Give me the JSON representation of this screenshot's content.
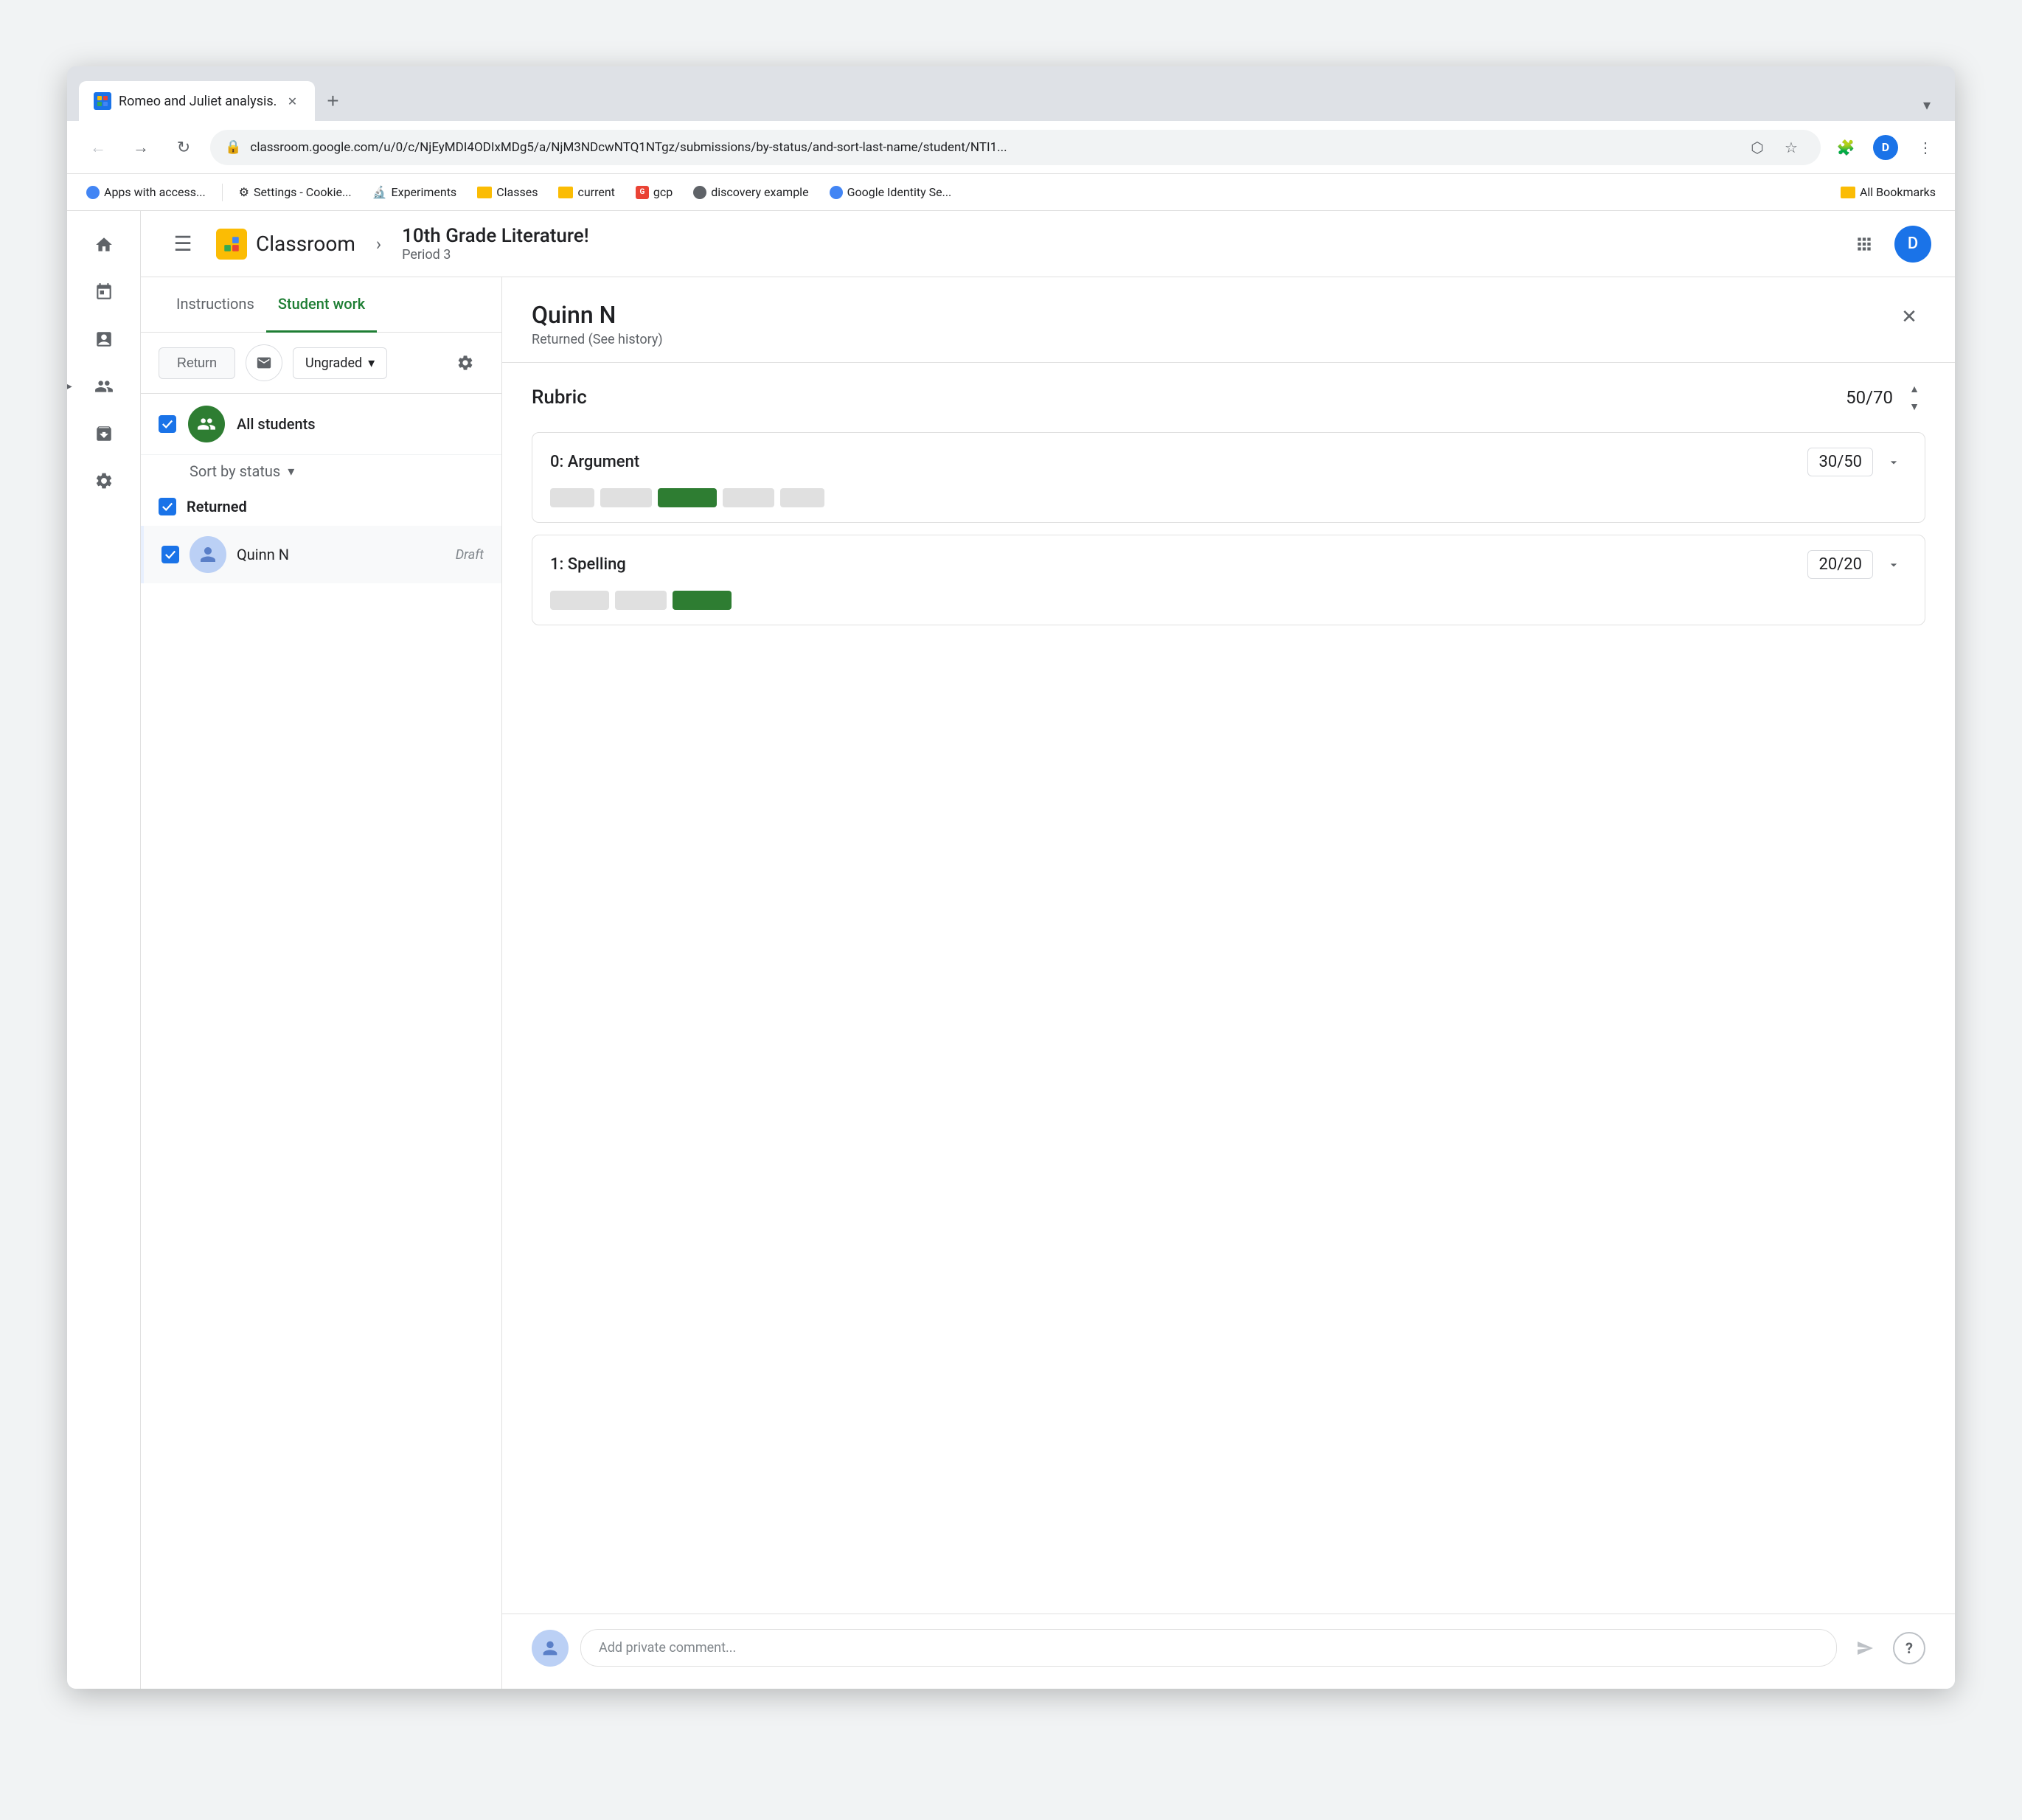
{
  "browser": {
    "tab_title": "Romeo and Juliet analysis.",
    "url": "classroom.google.com/u/0/c/NjEyMDI4ODIxMDg5/a/NjM3NDcwNTQ1NTgz/submissions/by-status/and-sort-last-name/student/NTI1...",
    "new_tab_label": "+",
    "chevron_label": "▾",
    "bookmarks": [
      {
        "label": "Apps with access...",
        "type": "google"
      },
      {
        "label": "Settings - Cookie...",
        "type": "settings"
      },
      {
        "label": "Experiments",
        "type": "experiments"
      },
      {
        "label": "Classes",
        "type": "folder"
      },
      {
        "label": "current",
        "type": "folder"
      },
      {
        "label": "gcp",
        "type": "gcp"
      },
      {
        "label": "discovery example",
        "type": "discovery"
      },
      {
        "label": "Google Identity Se...",
        "type": "google"
      },
      {
        "label": "All Bookmarks",
        "type": "bookmarks"
      }
    ]
  },
  "app": {
    "logo_text": "Classroom",
    "logo_initial": "C",
    "course_name": "10th Grade Literature!",
    "period": "Period 3",
    "user_initial": "D"
  },
  "tabs": {
    "instructions": "Instructions",
    "student_work": "Student work"
  },
  "toolbar": {
    "return_label": "Return",
    "grade_label": "Ungraded",
    "dropdown_arrow": "▾"
  },
  "student_list": {
    "all_students_label": "All students",
    "sort_label": "Sort by status",
    "sort_arrow": "▾",
    "section_label": "Returned",
    "students": [
      {
        "name": "Quinn N",
        "status": "Draft",
        "selected": true
      }
    ]
  },
  "detail": {
    "student_name": "Quinn N",
    "student_status": "Returned (See history)",
    "rubric_title": "Rubric",
    "rubric_total_score": "50",
    "rubric_total_max": "70",
    "criteria": [
      {
        "name": "0: Argument",
        "score": "30",
        "max": "50",
        "bars": [
          {
            "type": "empty",
            "width": 60
          },
          {
            "type": "empty",
            "width": 70
          },
          {
            "type": "selected",
            "width": 80
          },
          {
            "type": "empty",
            "width": 70
          },
          {
            "type": "empty",
            "width": 60
          }
        ]
      },
      {
        "name": "1: Spelling",
        "score": "20",
        "max": "20",
        "bars": [
          {
            "type": "empty",
            "width": 80
          },
          {
            "type": "empty",
            "width": 70
          },
          {
            "type": "selected",
            "width": 80
          }
        ]
      }
    ],
    "comment_placeholder": "Add private comment..."
  }
}
